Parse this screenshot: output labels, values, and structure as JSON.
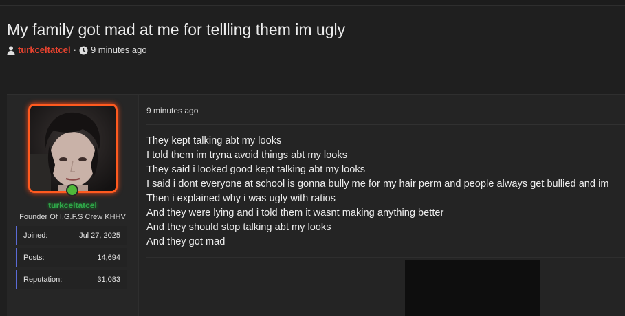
{
  "thread": {
    "title": "My family got mad at me for tellling them im ugly",
    "author": "turkceltatcel",
    "separator": "·",
    "time": "9 minutes ago"
  },
  "post": {
    "user": {
      "username": "turkceltatcel",
      "title": "Founder Of I.G.F.S Crew KHHV",
      "stats": [
        {
          "label": "Joined:",
          "value": "Jul 27, 2025"
        },
        {
          "label": "Posts:",
          "value": "14,694"
        },
        {
          "label": "Reputation:",
          "value": "31,083"
        }
      ]
    },
    "date": "9 minutes ago",
    "lines": [
      "They kept talking abt my looks",
      "I told them im tryna avoid things abt my looks",
      "They said i looked good kept talking abt my looks",
      "I said i dont everyone at school is gonna bully me for my hair perm and people always get bullied and im",
      "Then i explained why i was ugly with ratios",
      "And they were lying and i told them it wasnt making anything better",
      "And they should stop talking abt my looks",
      "And they got mad"
    ]
  },
  "icons": {
    "author": "user-icon",
    "time": "clock-icon"
  },
  "colors": {
    "username": "#e8432f",
    "avatar_border": "#ff5a1f",
    "online": "#4fb83a",
    "stat_accent": "#5b6bd6",
    "post_username": "#2fa84a"
  }
}
